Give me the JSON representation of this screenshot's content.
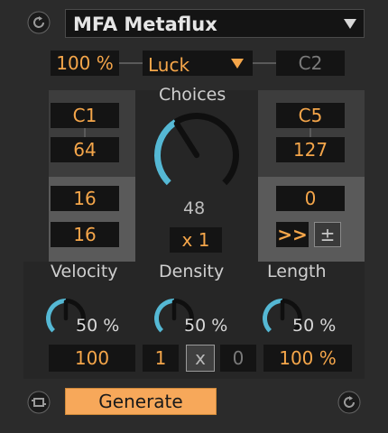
{
  "header": {
    "refresh_icon": "refresh-icon",
    "preset": "MFA Metaflux",
    "dropdown_icon": "triangle-down-icon"
  },
  "top_row": {
    "percent": "100 %",
    "mode": "Luck",
    "mode_icon": "triangle-down-icon",
    "note": "C2"
  },
  "choices": {
    "label": "Choices",
    "value": "48",
    "multiplier": "x 1",
    "knob_level": 0.38
  },
  "left": {
    "note": "C1",
    "velocity": "64",
    "a": "16",
    "b": "16"
  },
  "right": {
    "note": "C5",
    "velocity": "127",
    "value": "0",
    "shift_label": ">>",
    "plusminus_label": "±"
  },
  "velocity": {
    "label": "Velocity",
    "pct": "50 %",
    "value": "100",
    "level": 0.5
  },
  "density": {
    "label": "Density",
    "pct": "50 %",
    "left_value": "1",
    "toggle": "x",
    "right_value": "0",
    "level": 0.5
  },
  "length": {
    "label": "Length",
    "pct": "50 %",
    "value": "100 %",
    "level": 0.5
  },
  "footer": {
    "left_icon": "loop-icon",
    "generate": "Generate",
    "right_icon": "refresh-icon"
  },
  "colors": {
    "accent": "#f5a64a",
    "arc": "#55b8d4",
    "button": "#f7a85a"
  }
}
